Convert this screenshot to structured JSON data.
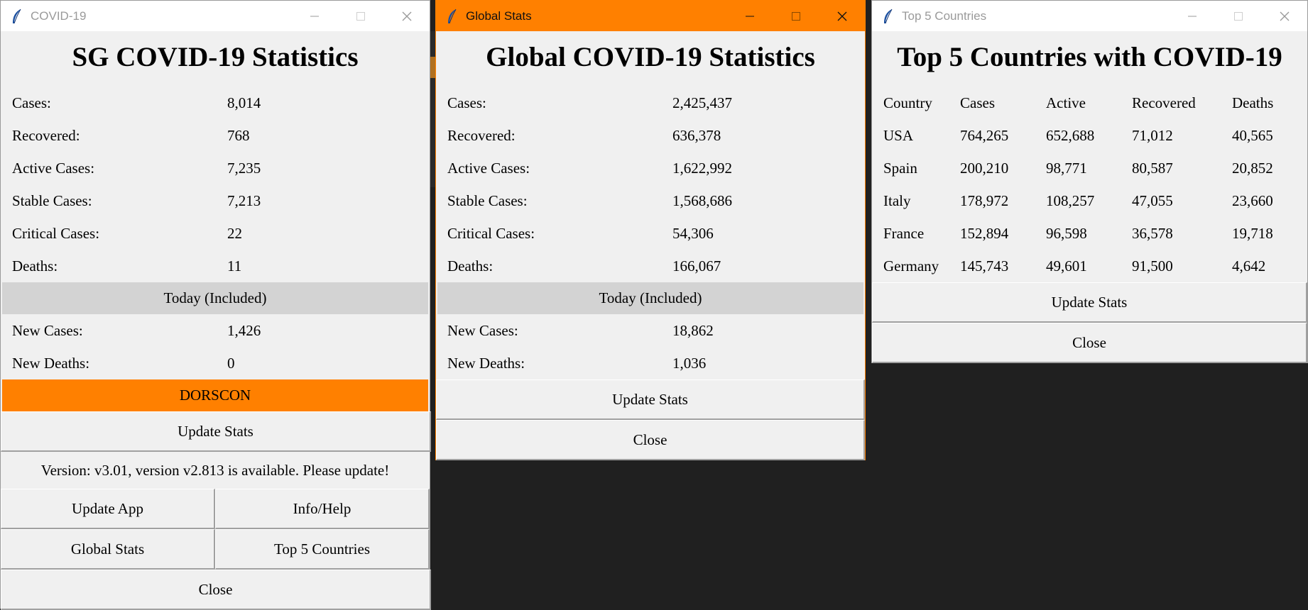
{
  "sg_window": {
    "title": "COVID-19",
    "heading": "SG COVID-19 Statistics",
    "stats": [
      {
        "label": "Cases:",
        "value": "8,014"
      },
      {
        "label": "Recovered:",
        "value": "768"
      },
      {
        "label": "Active Cases:",
        "value": "7,235"
      },
      {
        "label": "Stable Cases:",
        "value": "7,213"
      },
      {
        "label": "Critical Cases:",
        "value": "22"
      },
      {
        "label": "Deaths:",
        "value": "11"
      }
    ],
    "today_label": "Today (Included)",
    "today": [
      {
        "label": "New Cases:",
        "value": "1,426"
      },
      {
        "label": "New Deaths:",
        "value": "0"
      }
    ],
    "dorscon_label": "DORSCON",
    "dorscon_color": "#ff8000",
    "update_stats_label": "Update Stats",
    "version_text": "Version: v3.01, version v2.813 is available. Please update!",
    "update_app_label": "Update App",
    "info_help_label": "Info/Help",
    "global_stats_label": "Global Stats",
    "top5_label": "Top 5 Countries",
    "close_label": "Close"
  },
  "global_window": {
    "title": "Global Stats",
    "heading": "Global COVID-19 Statistics",
    "stats": [
      {
        "label": "Cases:",
        "value": "2,425,437"
      },
      {
        "label": "Recovered:",
        "value": "636,378"
      },
      {
        "label": "Active Cases:",
        "value": "1,622,992"
      },
      {
        "label": "Stable Cases:",
        "value": "1,568,686"
      },
      {
        "label": "Critical Cases:",
        "value": "54,306"
      },
      {
        "label": "Deaths:",
        "value": "166,067"
      }
    ],
    "today_label": "Today (Included)",
    "today": [
      {
        "label": "New Cases:",
        "value": "18,862"
      },
      {
        "label": "New Deaths:",
        "value": "1,036"
      }
    ],
    "update_stats_label": "Update Stats",
    "close_label": "Close"
  },
  "top5_window": {
    "title": "Top 5 Countries",
    "heading": "Top 5 Countries with COVID-19",
    "columns": [
      "Country",
      "Cases",
      "Active",
      "Recovered",
      "Deaths"
    ],
    "rows": [
      [
        "USA",
        "764,265",
        "652,688",
        "71,012",
        "40,565"
      ],
      [
        "Spain",
        "200,210",
        "98,771",
        "80,587",
        "20,852"
      ],
      [
        "Italy",
        "178,972",
        "108,257",
        "47,055",
        "23,660"
      ],
      [
        "France",
        "152,894",
        "96,598",
        "36,578",
        "19,718"
      ],
      [
        "Germany",
        "145,743",
        "49,601",
        "91,500",
        "4,642"
      ]
    ],
    "update_stats_label": "Update Stats",
    "close_label": "Close"
  },
  "colors": {
    "active_titlebar": "#ff8000",
    "today_banner": "#d3d3d3",
    "desktop": "#202020"
  },
  "icons": [
    "feather-icon",
    "minimize-icon",
    "maximize-icon",
    "close-icon"
  ]
}
